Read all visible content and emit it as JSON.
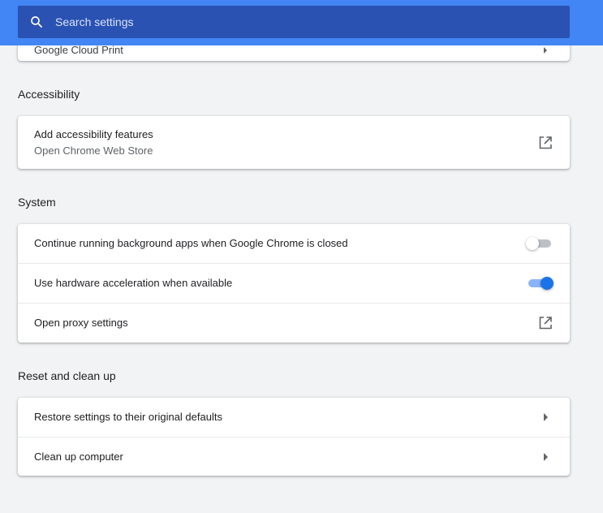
{
  "search": {
    "placeholder": "Search settings"
  },
  "partial_card": {
    "label": "Google Cloud Print"
  },
  "sections": {
    "accessibility": {
      "title": "Accessibility",
      "add_features": {
        "label": "Add accessibility features",
        "sublabel": "Open Chrome Web Store",
        "icon": "external-link-icon"
      }
    },
    "system": {
      "title": "System",
      "background_apps": {
        "label": "Continue running background apps when Google Chrome is closed",
        "enabled": false
      },
      "hardware_accel": {
        "label": "Use hardware acceleration when available",
        "enabled": true
      },
      "proxy": {
        "label": "Open proxy settings",
        "icon": "external-link-icon"
      }
    },
    "reset": {
      "title": "Reset and clean up",
      "restore": {
        "label": "Restore settings to their original defaults",
        "icon": "chevron-right-icon"
      },
      "cleanup": {
        "label": "Clean up computer",
        "icon": "chevron-right-icon"
      }
    }
  },
  "colors": {
    "header_blue": "#4285f4",
    "search_bar": "#2a52b3",
    "toggle_on": "#1a73e8",
    "toggle_on_track": "#8ab4f8",
    "toggle_off_track": "#bdc1c6",
    "page_background": "#f1f3f4"
  }
}
